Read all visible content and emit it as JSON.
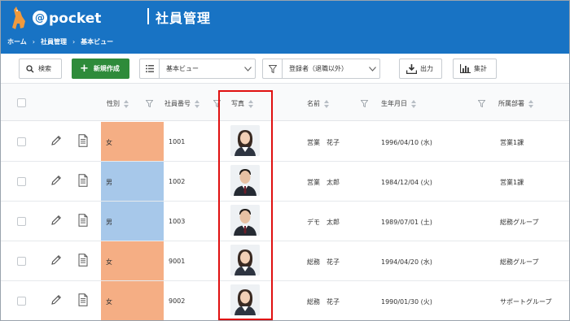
{
  "header": {
    "app_logo": "@pocket",
    "title": "社員管理",
    "breadcrumb": [
      "ホーム",
      "社員管理",
      "基本ビュー"
    ],
    "color": "#1873c4"
  },
  "toolbar": {
    "search_label": "検索",
    "new_label": "新規作成",
    "view_select": "基本ビュー",
    "filter_select": "登録者（退職以外）",
    "export_label": "出力",
    "summary_label": "集計",
    "new_color": "#2e8b3a"
  },
  "columns": {
    "gender": "性別",
    "employee_no": "社員番号",
    "photo": "写真",
    "name": "名前",
    "birthdate": "生年月日",
    "department": "所属部署"
  },
  "gender_colors": {
    "女": "#f5ae84",
    "男": "#a7c8ea"
  },
  "rows": [
    {
      "gender": "女",
      "employee_no": "1001",
      "name": "営業　花子",
      "birthdate": "1996/04/10 (水)",
      "department": "営業1課",
      "photo": "female-employee-photo"
    },
    {
      "gender": "男",
      "employee_no": "1002",
      "name": "営業　太郎",
      "birthdate": "1984/12/04 (火)",
      "department": "営業1課",
      "photo": "male-employee-photo"
    },
    {
      "gender": "男",
      "employee_no": "1003",
      "name": "デモ　太郎",
      "birthdate": "1989/07/01 (土)",
      "department": "総務グループ",
      "photo": "male-employee-photo"
    },
    {
      "gender": "女",
      "employee_no": "9001",
      "name": "総務　花子",
      "birthdate": "1994/04/20 (水)",
      "department": "総務グループ",
      "photo": "female-employee-photo"
    },
    {
      "gender": "女",
      "employee_no": "9002",
      "name": "総務　花子",
      "birthdate": "1990/01/30 (火)",
      "department": "サポートグループ",
      "photo": "female-employee-photo"
    }
  ]
}
